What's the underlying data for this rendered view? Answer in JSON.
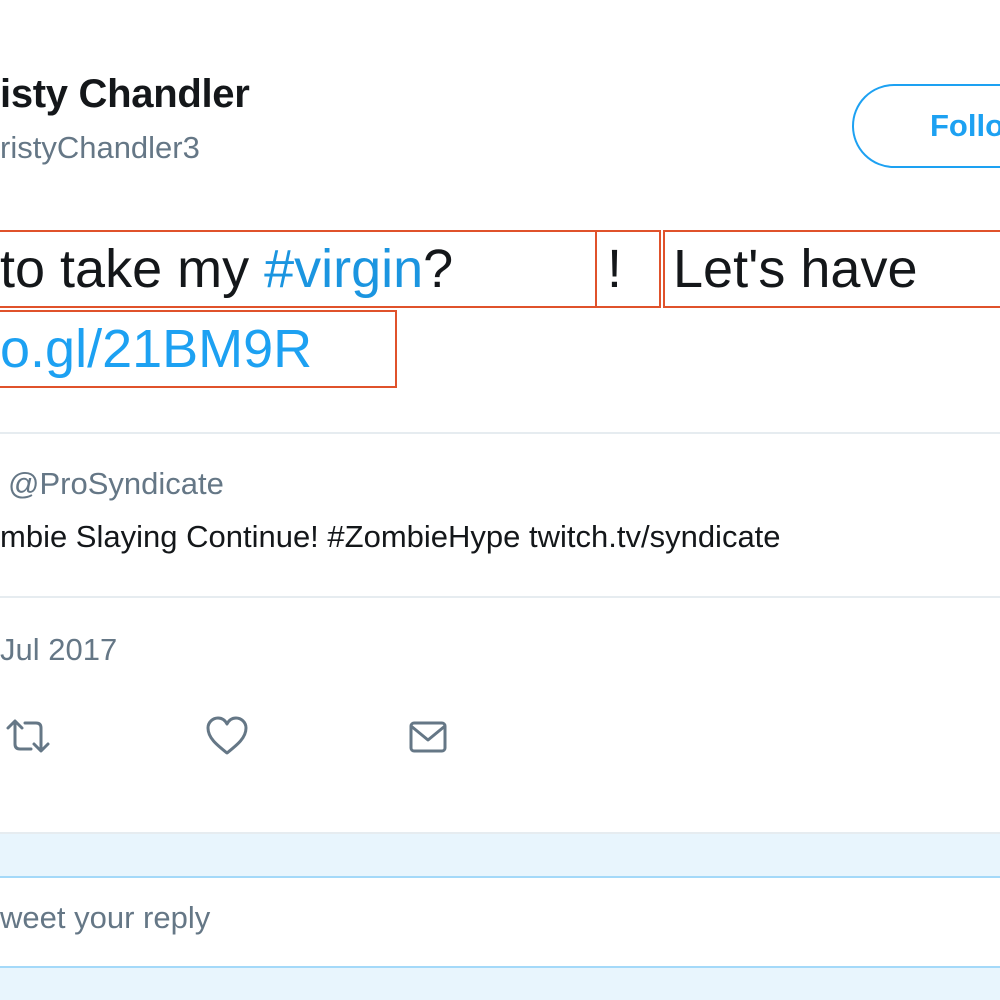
{
  "header": {
    "display_name": "isty Chandler",
    "handle": "ristyChandler3",
    "follow_label": "Follo"
  },
  "tweet": {
    "line1_part1": "to take my ",
    "line1_hashtag": "#virgin",
    "line1_part2": "?",
    "line1_bang": "!",
    "line1_part3": "Let's have",
    "line2_link": "o.gl/21BM9R"
  },
  "quoted_tweet": {
    "handle": "@ProSyndicate",
    "text": "mbie Slaying Continue! #ZombieHype twitch.tv/syndicate"
  },
  "timestamp": "Jul 2017",
  "actions": {
    "retweet_icon": "retweet-icon",
    "like_icon": "heart-icon",
    "dm_icon": "envelope-icon"
  },
  "reply": {
    "placeholder": "weet your reply"
  },
  "colors": {
    "brand_blue": "#1da1f2",
    "hashtag_blue": "#1b95e0",
    "muted_text": "#657786",
    "annotation_box": "#e0522b",
    "reply_background": "#e8f5fd"
  }
}
